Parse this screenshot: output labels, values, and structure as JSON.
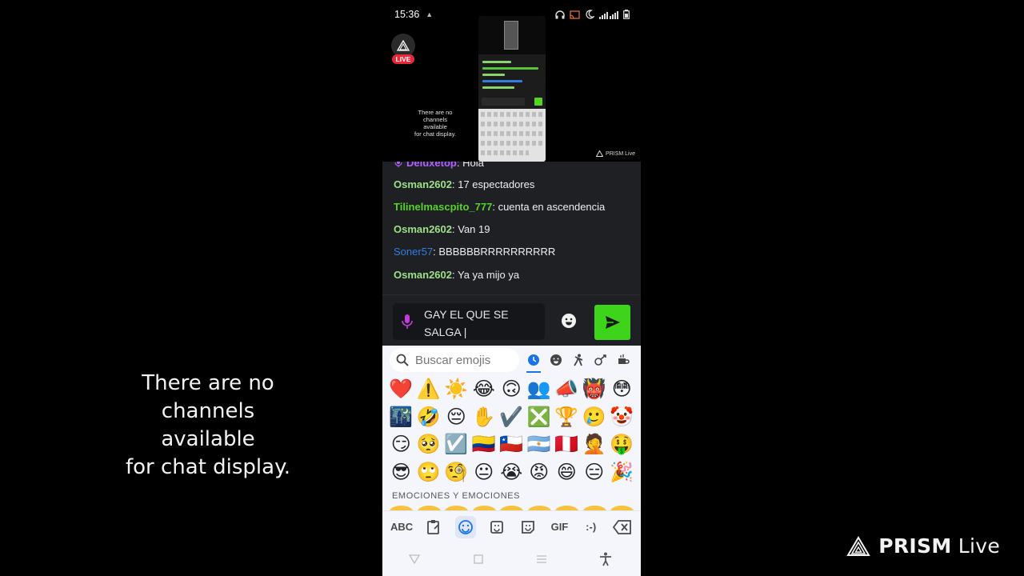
{
  "overlay": {
    "no_channels_text": "There are no\nchannels\navailable\nfor chat display.",
    "brand_bold": "PRISM",
    "brand_light": " Live"
  },
  "status_bar": {
    "time": "15:36",
    "icons": [
      "headphones-icon",
      "cast-icon",
      "moon-icon",
      "signal-icon",
      "battery-icon"
    ]
  },
  "stream": {
    "live_badge": "LIVE",
    "preview_note": "There are no\nchannels\navailable\nfor chat display.",
    "preview_brand": "PRISM Live"
  },
  "chat": {
    "messages": [
      {
        "user": "Deluxetop",
        "text": "Hola",
        "color": "#b061ff"
      },
      {
        "user": "Osman2602",
        "text": "17 espectadores",
        "color": "#9fe08b"
      },
      {
        "user": "Tilinelmascpito_777",
        "text": "cuenta en ascendencia",
        "color": "#57d22a"
      },
      {
        "user": "Osman2602",
        "text": "Van 19",
        "color": "#9fe08b"
      },
      {
        "user": "Soner57",
        "text": "BBBBBBRRRRRRRRRR",
        "color": "#2f7fe0"
      },
      {
        "user": "Osman2602",
        "text": "Ya ya mijo ya",
        "color": "#9fe08b"
      }
    ]
  },
  "composer": {
    "text": "GAY EL QUE SE SALGA |"
  },
  "emoji_keyboard": {
    "search_placeholder": "Buscar emojis",
    "categories": [
      "recent-icon",
      "smiley-icon",
      "person-icon",
      "activity-icon",
      "food-icon"
    ],
    "emojis": [
      "❤️",
      "⚠️",
      "☀️",
      "😂",
      "🙃",
      "👥",
      "📣",
      "👹",
      "😳",
      "🌃",
      "🤣",
      "😔",
      "✋",
      "✔️",
      "❎",
      "🏆",
      "🥲",
      "🤡",
      "😏",
      "🥺",
      "☑️",
      "🇨🇴",
      "🇨🇱",
      "🇦🇷",
      "🇵🇪",
      "🤦",
      "🤑",
      "😎",
      "🙄",
      "🧐",
      "😐",
      "😭",
      "😡",
      "😄",
      "😑",
      "🎉"
    ],
    "section_title": "EMOCIONES Y EMOCIONES"
  },
  "keyboard_toolbar": {
    "abc_label": "ABC",
    "gif_label": "GIF",
    "emoticon_label": ":-)"
  }
}
